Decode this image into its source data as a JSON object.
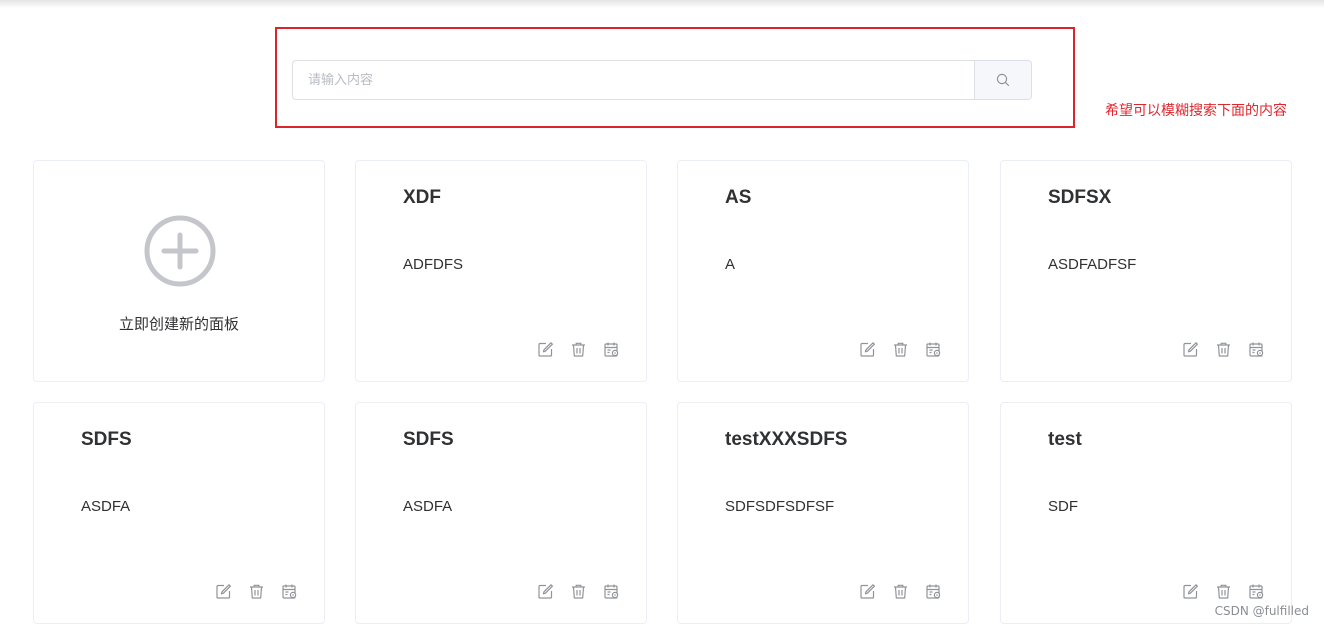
{
  "search": {
    "placeholder": "请输入内容",
    "value": ""
  },
  "annotation": "希望可以模糊搜索下面的内容",
  "create_card": {
    "label": "立即创建新的面板"
  },
  "cards": [
    {
      "title": "XDF",
      "description": "ADFDFS"
    },
    {
      "title": "AS",
      "description": "A"
    },
    {
      "title": "SDFSX",
      "description": "ASDFADFSF"
    },
    {
      "title": "SDFS",
      "description": "ASDFA"
    },
    {
      "title": "SDFS",
      "description": "ASDFA"
    },
    {
      "title": "testXXXSDFS",
      "description": "SDFSDFSDFSF"
    },
    {
      "title": "test",
      "description": "SDF"
    }
  ],
  "card_icons": [
    "edit-icon",
    "delete-icon",
    "calendar-settings-icon"
  ],
  "watermark": "CSDN @fulfilled",
  "colors": {
    "highlight": "#d9252b",
    "annotation_text": "#e0262d",
    "card_border": "#ebeef5",
    "icon": "#909399"
  }
}
